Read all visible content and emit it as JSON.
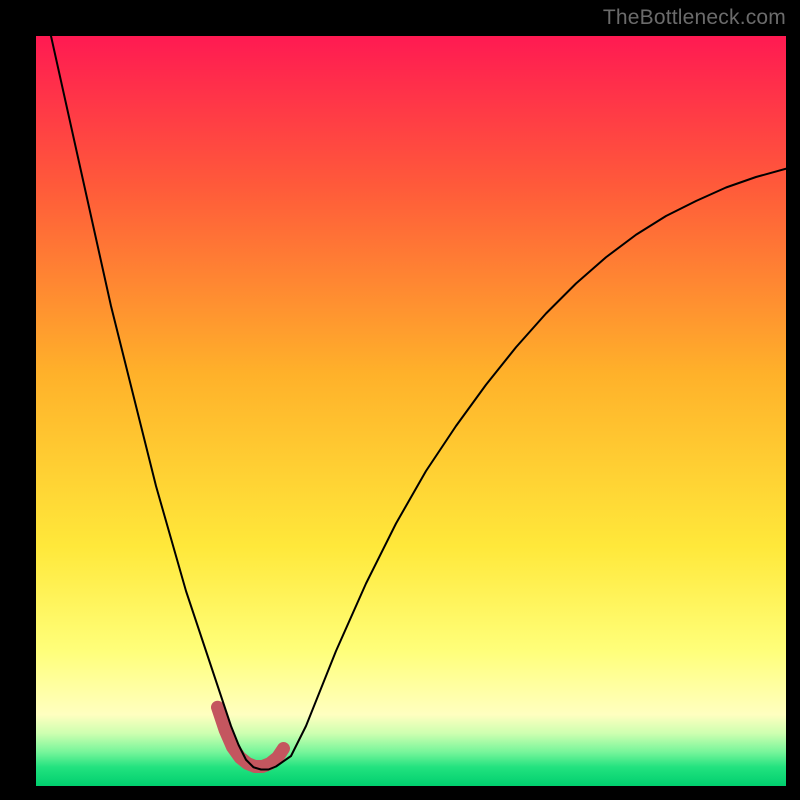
{
  "watermark": "TheBottleneck.com",
  "chart_data": {
    "type": "line",
    "title": "",
    "xlabel": "",
    "ylabel": "",
    "xlim": [
      0,
      100
    ],
    "ylim": [
      0,
      100
    ],
    "grid": false,
    "legend": false,
    "gradient_stops": [
      {
        "offset": 0.0,
        "color": "#ff1a52"
      },
      {
        "offset": 0.2,
        "color": "#ff5a3a"
      },
      {
        "offset": 0.45,
        "color": "#ffb12a"
      },
      {
        "offset": 0.68,
        "color": "#ffe83a"
      },
      {
        "offset": 0.82,
        "color": "#ffff7a"
      },
      {
        "offset": 0.905,
        "color": "#ffffc0"
      },
      {
        "offset": 0.93,
        "color": "#cdffb0"
      },
      {
        "offset": 0.955,
        "color": "#76f59a"
      },
      {
        "offset": 0.975,
        "color": "#22e27f"
      },
      {
        "offset": 1.0,
        "color": "#00cf6e"
      }
    ],
    "series": [
      {
        "name": "bottleneck-curve",
        "stroke": "#000000",
        "stroke_width": 2,
        "x": [
          2,
          4,
          6,
          8,
          10,
          12,
          14,
          16,
          18,
          20,
          22,
          24,
          25,
          26,
          27,
          28,
          29,
          30,
          31,
          32,
          34,
          36,
          38,
          40,
          44,
          48,
          52,
          56,
          60,
          64,
          68,
          72,
          76,
          80,
          84,
          88,
          92,
          96,
          100
        ],
        "y": [
          100,
          91,
          82,
          73,
          64,
          56,
          48,
          40,
          33,
          26,
          20,
          14,
          11,
          8,
          5.5,
          3.5,
          2.5,
          2.2,
          2.2,
          2.6,
          4,
          8,
          13,
          18,
          27,
          35,
          42,
          48,
          53.5,
          58.5,
          63,
          67,
          70.5,
          73.5,
          76,
          78,
          79.8,
          81.2,
          82.3
        ]
      }
    ],
    "highlight": {
      "name": "min-band",
      "stroke": "#c4565f",
      "stroke_width": 13,
      "x": [
        24.2,
        25.2,
        26.2,
        27.2,
        28.2,
        29.2,
        30.2,
        31.2,
        32.2,
        33.0
      ],
      "y": [
        10.5,
        7.5,
        5.2,
        3.8,
        3.0,
        2.6,
        2.6,
        3.0,
        3.8,
        5.0
      ]
    }
  }
}
